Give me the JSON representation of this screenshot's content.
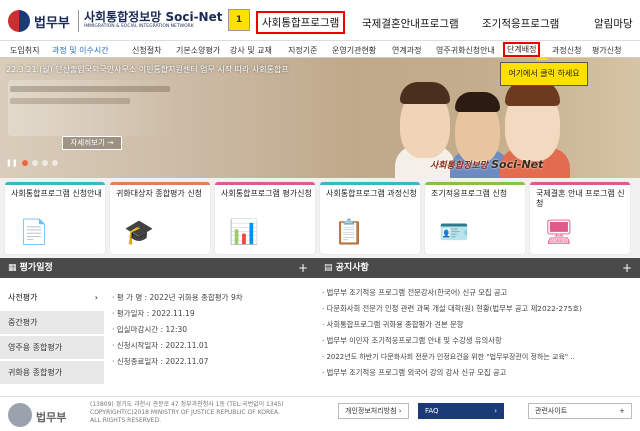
{
  "header": {
    "logo_text": "법무부",
    "brand_title": "사회통합정보망 Soci-Net",
    "brand_sub": "IMMIGRATION & SOCIAL INTEGRATION NETWORK",
    "step_badge": "1",
    "utility": "관련사이트",
    "nav": [
      "사회통합프로그램",
      "국제결혼안내프로그램",
      "조기적응프로그램",
      "알림마당"
    ]
  },
  "subnav": [
    "도입취지",
    "과정 및 이수시간",
    "신청절차",
    "기본소양평가",
    "강사 및 교재",
    "지정기준",
    "운영기관현황",
    "연계과정",
    "영주귀화신청안내",
    "단계배정",
    "과정신청",
    "평가신청"
  ],
  "hero": {
    "ticker": "22.3.21.(월) 안산출입국외국인사무소 이민통합지원센터 업무 시작 따라 사회통합프",
    "callout": "여기에서 클릭 하세요",
    "more_button": "자세히보기 →",
    "pause": "❚❚",
    "logo_script": "사회통합정보망",
    "logo_sn": "Soci-Net"
  },
  "cards": [
    {
      "title": "사회통합프로그램 신청안내",
      "color": "#3fb6c8",
      "icon": "📄"
    },
    {
      "title": "귀화대상자 종합평가 신청",
      "color": "#e0805a",
      "icon": "🎓"
    },
    {
      "title": "사회통합프로그램 평가신청",
      "color": "#e05a8a",
      "icon": "📊"
    },
    {
      "title": "사회통합프로그램 과정신청",
      "color": "#3fb6c8",
      "icon": "📋"
    },
    {
      "title": "조기적응프로그램 신청",
      "color": "#8ac04a",
      "icon": "🪪"
    },
    {
      "title": "국제결혼 안내 프로그램 신청",
      "color": "#e05a8a",
      "icon": "🖥"
    }
  ],
  "eval_panel": {
    "title": "평가일정",
    "plus": "+",
    "tabs": [
      "사전평가",
      "중간평가",
      "영주용 종합평가",
      "귀화용 종합평가"
    ],
    "rows": [
      "· 평 가 명 : 2022년 귀화용 종합평가 9차",
      "· 평가일자 : 2022.11.19",
      "· 입실마감시간 : 12:30",
      "· 신청시작일자 : 2022.11.01",
      "· 신청종료일자 : 2022.11.07"
    ]
  },
  "notice_panel": {
    "title": "공지사항",
    "plus": "+",
    "rows": [
      "· 법무부 조기적응 프로그램 전문강사(한국어) 신규 모집 공고",
      "· 다문화사회 전문가 인정 관련 과목 개설 대학(원) 현황(법무부 공고 제2022-275호)",
      "· 사회통합프로그램 귀화용 종합평가 견본 문항",
      "· 법무부 이민자 조기적응프로그램 안내 및 수강생 유의사항",
      "· 2022년도 하반기 다문화사회 전문가 인정요건을 위한 \"법무부장관이 정하는 교육\" ..",
      "· 법무부 조기적응 프로그램 외국어 강의 강사 신규 모집 공고"
    ]
  },
  "footer": {
    "logo": "법무부",
    "address": [
      "(13809) 경기도 과천시 관문로 47 정부과천청사 1동 (TEL:국번없이 1345)",
      "COPYRIGHT(C)2018 MINISTRY OF JUSTICE REPUBLIC OF KOREA.",
      "ALL RIGHTS RESERVED."
    ],
    "privacy": "개인정보처리방침 ›",
    "faq": "FAQ",
    "faq_arrow": "›",
    "related": "관련사이트",
    "related_plus": "+"
  }
}
